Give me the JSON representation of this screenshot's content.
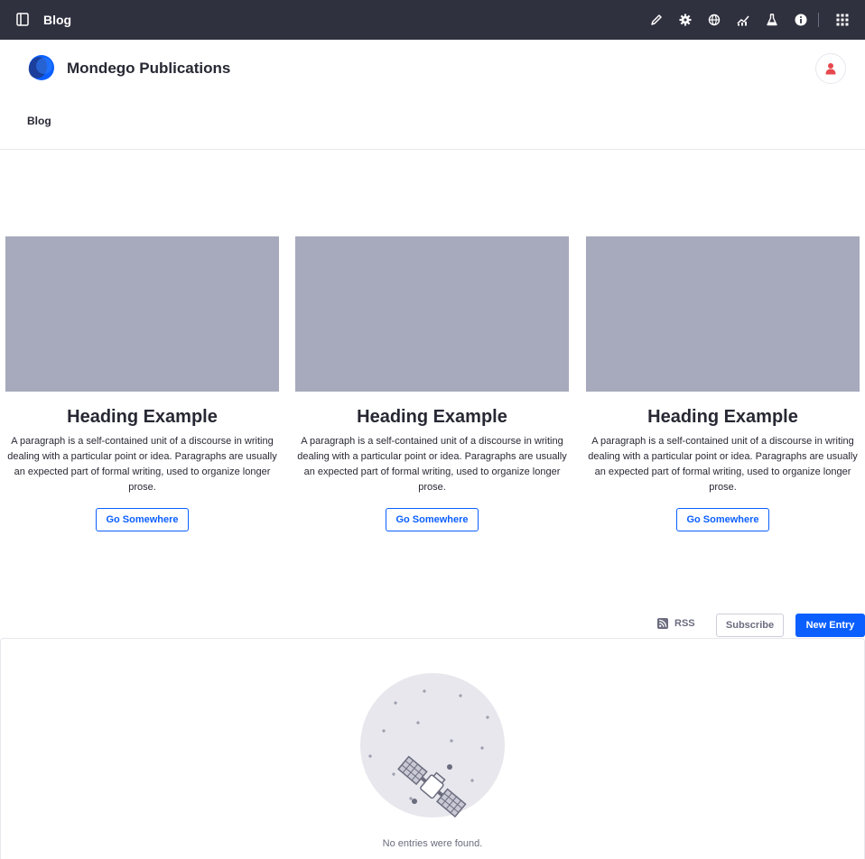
{
  "control_bar": {
    "title": "Blog",
    "icons": [
      "sidebar-toggle-icon",
      "pencil-icon",
      "gear-icon",
      "globe-icon",
      "analytics-icon",
      "flask-icon",
      "info-icon",
      "apps-grid-icon"
    ]
  },
  "site": {
    "name": "Mondego Publications",
    "nav_items": [
      {
        "label": "Blog"
      }
    ]
  },
  "cards": [
    {
      "heading": "Heading Example",
      "text": "A paragraph is a self-contained unit of a discourse in writing dealing with a particular point or idea. Paragraphs are usually an expected part of formal writing, used to organize longer prose.",
      "button_label": "Go Somewhere"
    },
    {
      "heading": "Heading Example",
      "text": "A paragraph is a self-contained unit of a discourse in writing dealing with a particular point or idea. Paragraphs are usually an expected part of formal writing, used to organize longer prose.",
      "button_label": "Go Somewhere"
    },
    {
      "heading": "Heading Example",
      "text": "A paragraph is a self-contained unit of a discourse in writing dealing with a particular point or idea. Paragraphs are usually an expected part of formal writing, used to organize longer prose.",
      "button_label": "Go Somewhere"
    }
  ],
  "blog_toolbar": {
    "rss_label": "RSS",
    "subscribe_label": "Subscribe",
    "new_entry_label": "New Entry"
  },
  "empty_state": {
    "message": "No entries were found."
  },
  "colors": {
    "control_bar_bg": "#30313f",
    "primary": "#0b5fff",
    "card_placeholder": "#a7a9bc",
    "avatar_icon": "#e5484d"
  }
}
